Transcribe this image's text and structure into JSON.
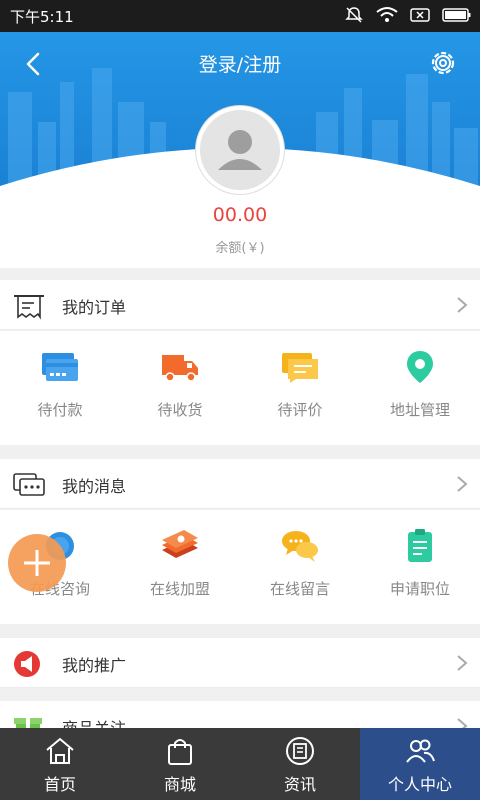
{
  "status_bar": {
    "time": "下午5:11"
  },
  "header": {
    "title": "登录/注册",
    "balance": "00.00",
    "balance_label": "余额(￥)"
  },
  "orders": {
    "title": "我的订单",
    "items": [
      {
        "label": "待付款",
        "icon": "card-icon"
      },
      {
        "label": "待收货",
        "icon": "truck-icon"
      },
      {
        "label": "待评价",
        "icon": "comment-icon"
      },
      {
        "label": "地址管理",
        "icon": "location-pin-icon"
      }
    ]
  },
  "messages": {
    "title": "我的消息",
    "items": [
      {
        "label": "在线咨询",
        "icon": "headset-icon"
      },
      {
        "label": "在线加盟",
        "icon": "money-stack-icon"
      },
      {
        "label": "在线留言",
        "icon": "chat-bubbles-icon"
      },
      {
        "label": "申请职位",
        "icon": "clipboard-icon"
      }
    ]
  },
  "promotion": {
    "title": "我的推广"
  },
  "favorites": {
    "title": "商品关注"
  },
  "tabbar": {
    "tabs": [
      {
        "label": "首页",
        "icon": "home-icon"
      },
      {
        "label": "商城",
        "icon": "shopping-bag-icon"
      },
      {
        "label": "资讯",
        "icon": "news-icon"
      },
      {
        "label": "个人中心",
        "icon": "people-icon",
        "active": true
      }
    ]
  },
  "colors": {
    "header_blue": "#1e88dd",
    "balance_red": "#e8453c",
    "active_tab": "#2c4f8c",
    "tabbar": "#3a3a3a"
  }
}
